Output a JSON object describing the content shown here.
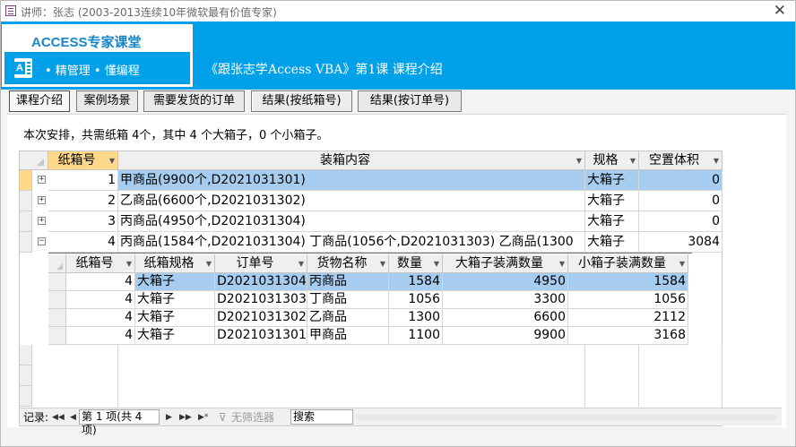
{
  "window": {
    "title": "讲师：张志 (2003-2013连续10年微软最有价值专家)",
    "close_glyph": "✕"
  },
  "banner": {
    "logo_title": "ACCESS专家课堂",
    "logo_letter": "A",
    "tagline": "•  精管理  • 懂编程",
    "title": "《跟张志学Access VBA》第1课 课程介绍"
  },
  "tabs": [
    {
      "label": "课程介绍"
    },
    {
      "label": "案例场景"
    },
    {
      "label": "需要发货的订单"
    },
    {
      "label": "结果(按纸箱号)"
    },
    {
      "label": "结果(按订单号)"
    }
  ],
  "summary": "本次安排，共需纸箱 4个，其中 4 个大箱子，0 个小箱子。",
  "sheet": {
    "columns": [
      "纸箱号",
      "装箱内容",
      "规格",
      "空置体积"
    ],
    "rows": [
      {
        "box": "1",
        "content": "甲商品(9900个,D2021031301)",
        "spec": "大箱子",
        "space": "0",
        "expander": "+"
      },
      {
        "box": "2",
        "content": "乙商品(6600个,D2021031302)",
        "spec": "大箱子",
        "space": "0",
        "expander": "+"
      },
      {
        "box": "3",
        "content": "丙商品(4950个,D2021031304)",
        "spec": "大箱子",
        "space": "0",
        "expander": "+"
      },
      {
        "box": "4",
        "content": "丙商品(1584个,D2021031304) 丁商品(1056个,D2021031303) 乙商品(1300",
        "spec": "大箱子",
        "space": "3084",
        "expander": "−"
      }
    ]
  },
  "subsheet": {
    "columns": [
      "纸箱号",
      "纸箱规格",
      "订单号",
      "货物名称",
      "数量",
      "大箱子装满数量",
      "小箱子装满数量"
    ],
    "rows": [
      {
        "box": "4",
        "spec": "大箱子",
        "order": "D2021031304",
        "goods": "丙商品",
        "qty": "1584",
        "big_full": "4950",
        "small_full": "1584"
      },
      {
        "box": "4",
        "spec": "大箱子",
        "order": "D2021031303",
        "goods": "丁商品",
        "qty": "1056",
        "big_full": "3300",
        "small_full": "1056"
      },
      {
        "box": "4",
        "spec": "大箱子",
        "order": "D2021031302",
        "goods": "乙商品",
        "qty": "1300",
        "big_full": "6600",
        "small_full": "2112"
      },
      {
        "box": "4",
        "spec": "大箱子",
        "order": "D2021031301",
        "goods": "甲商品",
        "qty": "1100",
        "big_full": "9900",
        "small_full": "3168"
      }
    ]
  },
  "navbar": {
    "record_label": "记录:",
    "first": "◀◀",
    "prev": "◀",
    "record_text": "第 1 项(共 4 项)",
    "next": "▶",
    "last": "▶▶",
    "new": "▶*",
    "filter": "无筛选器",
    "search": "搜索"
  }
}
